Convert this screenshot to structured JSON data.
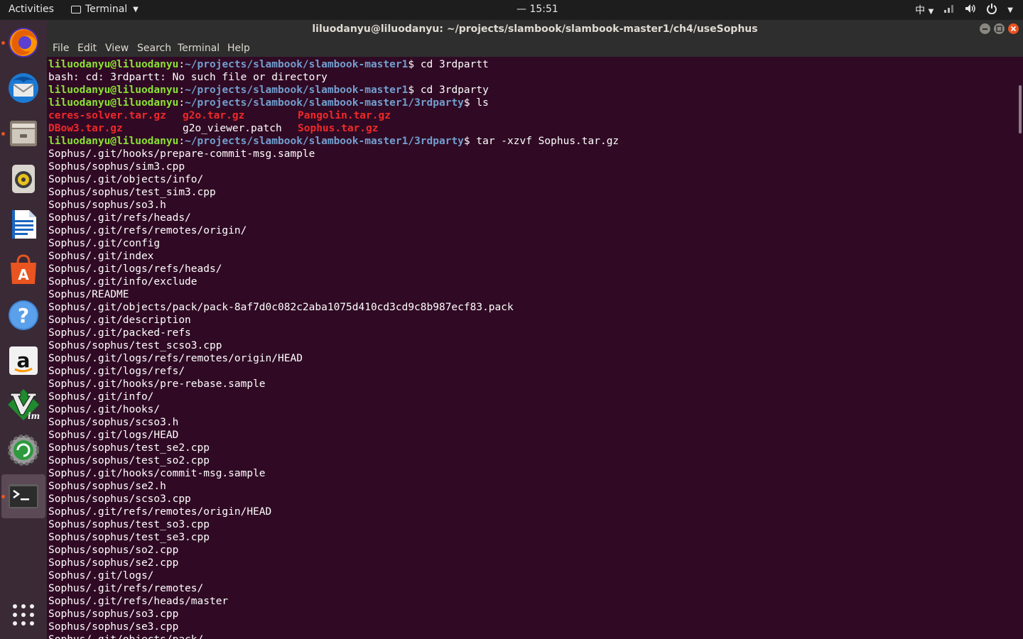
{
  "topbar": {
    "activities": "Activities",
    "app_name": "Terminal",
    "clock": "— 15:51",
    "input_method": "中"
  },
  "dock": {
    "items": [
      {
        "name": "firefox-icon"
      },
      {
        "name": "thunderbird-icon"
      },
      {
        "name": "files-icon"
      },
      {
        "name": "rhythmbox-icon"
      },
      {
        "name": "libreoffice-writer-icon"
      },
      {
        "name": "ubuntu-software-icon"
      },
      {
        "name": "help-icon"
      },
      {
        "name": "amazon-icon"
      },
      {
        "name": "vim-icon"
      },
      {
        "name": "software-updater-icon"
      },
      {
        "name": "terminal-icon"
      }
    ],
    "apps_grid": "show-applications-icon"
  },
  "window": {
    "title": "liluodanyu@liluodanyu: ~/projects/slambook/slambook-master1/ch4/useSophus",
    "menu": [
      "File",
      "Edit",
      "View",
      "Search",
      "Terminal",
      "Help"
    ]
  },
  "terminal": {
    "prompt_user": "liluodanyu@liluodanyu",
    "prompt_path_1": "~/projects/slambook/slambook-master1",
    "prompt_path_2": "~/projects/slambook/slambook-master1/3rdparty",
    "cmd_1": "cd 3rdpartt",
    "err_1": "bash: cd: 3rdpartt: No such file or directory",
    "cmd_2": "cd 3rdparty",
    "cmd_3": "ls",
    "ls_row1": [
      "ceres-solver.tar.gz",
      "g2o.tar.gz",
      "Pangolin.tar.gz"
    ],
    "ls_row2": [
      "DBow3.tar.gz",
      "g2o_viewer.patch",
      "Sophus.tar.gz"
    ],
    "cmd_4": "tar -xzvf Sophus.tar.gz",
    "output": [
      "Sophus/.git/hooks/prepare-commit-msg.sample",
      "Sophus/sophus/sim3.cpp",
      "Sophus/.git/objects/info/",
      "Sophus/sophus/test_sim3.cpp",
      "Sophus/sophus/so3.h",
      "Sophus/.git/refs/heads/",
      "Sophus/.git/refs/remotes/origin/",
      "Sophus/.git/config",
      "Sophus/.git/index",
      "Sophus/.git/logs/refs/heads/",
      "Sophus/.git/info/exclude",
      "Sophus/README",
      "Sophus/.git/objects/pack/pack-8af7d0c082c2aba1075d410cd3cd9c8b987ecf83.pack",
      "Sophus/.git/description",
      "Sophus/.git/packed-refs",
      "Sophus/sophus/test_scso3.cpp",
      "Sophus/.git/logs/refs/remotes/origin/HEAD",
      "Sophus/.git/logs/refs/",
      "Sophus/.git/hooks/pre-rebase.sample",
      "Sophus/.git/info/",
      "Sophus/.git/hooks/",
      "Sophus/sophus/scso3.h",
      "Sophus/.git/logs/HEAD",
      "Sophus/sophus/test_se2.cpp",
      "Sophus/sophus/test_so2.cpp",
      "Sophus/.git/hooks/commit-msg.sample",
      "Sophus/sophus/se2.h",
      "Sophus/sophus/scso3.cpp",
      "Sophus/.git/refs/remotes/origin/HEAD",
      "Sophus/sophus/test_so3.cpp",
      "Sophus/sophus/test_se3.cpp",
      "Sophus/sophus/so2.cpp",
      "Sophus/sophus/se2.cpp",
      "Sophus/.git/logs/",
      "Sophus/.git/refs/remotes/",
      "Sophus/.git/refs/heads/master",
      "Sophus/sophus/so3.cpp",
      "Sophus/sophus/se3.cpp",
      "Sophus/.git/objects/pack/"
    ]
  },
  "colors": {
    "terminal_bg": "#300a24",
    "prompt_user": "#8ae234",
    "prompt_path": "#729fcf",
    "archive_red": "#ef2929"
  }
}
